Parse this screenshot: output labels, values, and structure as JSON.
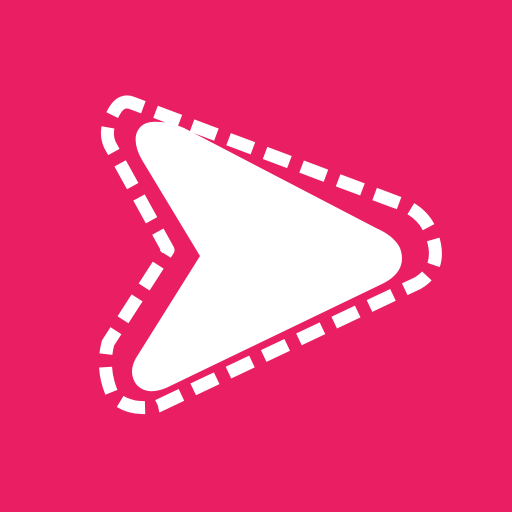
{
  "icon": {
    "name": "play-arrow-stitched-icon",
    "colors": {
      "background": "#E91E63",
      "foreground": "#FFFFFF"
    }
  }
}
